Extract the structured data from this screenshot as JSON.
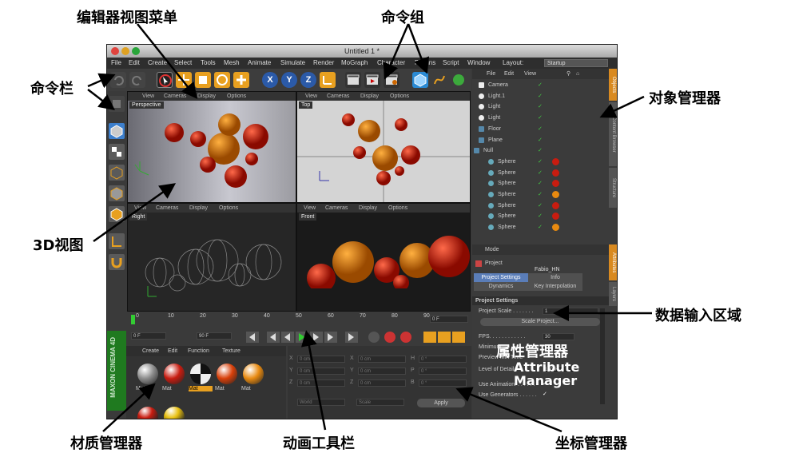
{
  "annotations": {
    "editor_menu": "编辑器视图菜单",
    "command_group": "命令组",
    "command_bar": "命令栏",
    "object_manager": "对象管理器",
    "viewport_3d": "3D视图",
    "data_input": "数据输入区域",
    "attribute_manager": "属性管理器",
    "attribute_manager_en": "Attribute Manager",
    "material_manager": "材质管理器",
    "animation_toolbar": "动画工具栏",
    "coordinate_manager": "坐标管理器"
  },
  "window": {
    "title": "Untitled 1 *"
  },
  "menu": {
    "items": [
      "File",
      "Edit",
      "Create",
      "Select",
      "Tools",
      "Mesh",
      "Animate",
      "Simulate",
      "Render",
      "MoGraph",
      "Character",
      "Plugins",
      "Script",
      "Window"
    ],
    "layout_label": "Layout:",
    "layout_value": "Startup"
  },
  "toolbar": {
    "axis_x": "X",
    "axis_y": "Y",
    "axis_z": "Z"
  },
  "viewports": {
    "menu": [
      "View",
      "Cameras",
      "Display",
      "Options"
    ],
    "labels": [
      "Perspective",
      "Top",
      "Right",
      "Front"
    ]
  },
  "objects": {
    "menu": [
      "File",
      "Edit",
      "View"
    ],
    "items": [
      "Camera",
      "Light.1",
      "Light",
      "Light",
      "Floor",
      "Plane",
      "Null",
      "Sphere",
      "Sphere",
      "Sphere",
      "Sphere",
      "Sphere",
      "Sphere",
      "Sphere"
    ],
    "tabs": [
      "Objects",
      "Content Browser",
      "Structure"
    ]
  },
  "attributes": {
    "mode_label": "Mode",
    "project_label": "Project",
    "author": "Fabio_HN",
    "tabs": [
      "Project Settings",
      "Info",
      "Dynamics",
      "Key Interpolation"
    ],
    "section": "Project Settings",
    "rows": [
      {
        "label": "Project Scale . . . . . . .",
        "value": "1"
      },
      {
        "label": "FPS. . . . . . . . . . . .",
        "value": "30"
      },
      {
        "label": "Minimum",
        "value": ""
      },
      {
        "label": "Preview Min Time",
        "value": ""
      },
      {
        "label": "Level of Detail",
        "value": "100 %"
      },
      {
        "label": "Use Animation. . . . . . .",
        "value": ""
      },
      {
        "label": "Use Generators . . . . . .",
        "value": ""
      }
    ],
    "scale_button": "Scale Project...",
    "side_tabs": [
      "Attributes",
      "Layers"
    ]
  },
  "timeline": {
    "ticks": [
      "0",
      "10",
      "20",
      "30",
      "40",
      "50",
      "60",
      "70",
      "80",
      "90"
    ],
    "end_frame": "0 F"
  },
  "animation": {
    "start_frame": "0 F",
    "end_frame": "90 F"
  },
  "materials": {
    "menu": [
      "Create",
      "Edit",
      "Function",
      "Texture"
    ],
    "items": [
      "Mat.1",
      "Mat",
      "Mat",
      "Mat",
      "Mat"
    ],
    "brand": "MAXON CINEMA 4D",
    "colors": [
      "#8c8c8c",
      "#c81c10",
      "#111111",
      "#d8400a",
      "#e88a10"
    ]
  },
  "coordinates": {
    "rows": [
      {
        "a": "X",
        "av": "0 cm",
        "b": "X",
        "bv": "0 cm",
        "c": "H",
        "cv": "0 °"
      },
      {
        "a": "Y",
        "av": "0 cm",
        "b": "Y",
        "bv": "0 cm",
        "c": "P",
        "cv": "0 °"
      },
      {
        "a": "Z",
        "av": "0 cm",
        "b": "Z",
        "bv": "0 cm",
        "c": "B",
        "cv": "0 °"
      }
    ],
    "world": "World",
    "scale": "Scale",
    "apply": "Apply"
  }
}
